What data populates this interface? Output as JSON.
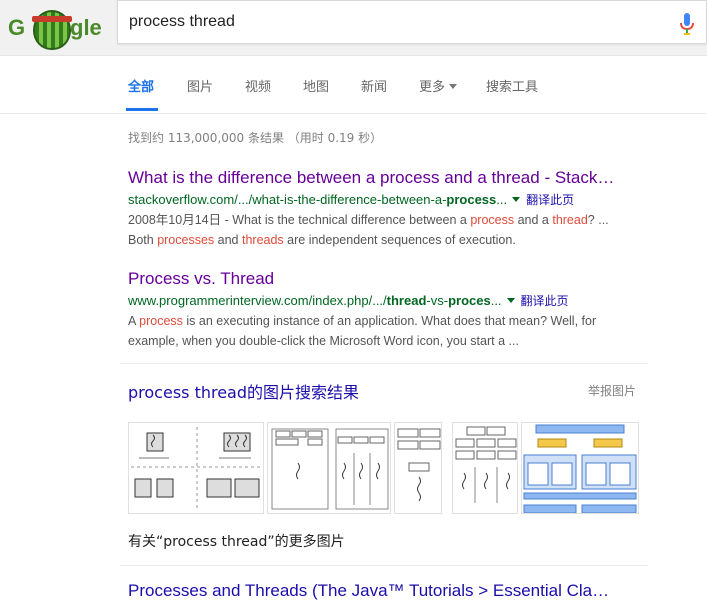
{
  "search": {
    "query": "process thread"
  },
  "tabs": [
    {
      "label": "全部"
    },
    {
      "label": "图片"
    },
    {
      "label": "视频"
    },
    {
      "label": "地图"
    },
    {
      "label": "新闻"
    },
    {
      "label": "更多"
    },
    {
      "label": "搜索工具"
    }
  ],
  "stats": "找到约 113,000,000 条结果 （用时 0.19 秒）",
  "results": [
    {
      "title": "What is the difference between a process and a thread - Stack…",
      "url_prefix": "stackoverflow.com/.../what-is-the-difference-between-a-",
      "url_bold": "process",
      "url_suffix": "...",
      "translate": "翻译此页",
      "snippet": {
        "line1": {
          "a": "2008年10月14日 - What is the technical difference between a ",
          "b": "process",
          "c": " and a ",
          "d": "thread",
          "e": "? ..."
        },
        "line2": {
          "a": "Both ",
          "b": "processes",
          "c": " and ",
          "d": "threads",
          "e": " are independent sequences of execution."
        }
      }
    },
    {
      "title": "Process vs. Thread",
      "url_prefix": "www.programmerinterview.com/index.php/.../",
      "url_bold": "thread",
      "url_mid": "-vs-",
      "url_bold2": "proces",
      "url_suffix": "...",
      "translate": "翻译此页",
      "snippet": {
        "line1": {
          "a": "A ",
          "b": "process",
          "c": " is an executing instance of an application. What does that mean? Well, for"
        },
        "line2": "example, when you double-click the Microsoft Word icon, you start a ..."
      }
    }
  ],
  "images_section": {
    "heading": "process thread的图片搜索结果",
    "report": "举报图片",
    "more": "有关“process thread”的更多图片"
  },
  "last_result": {
    "title": "Processes and Threads (The Java™ Tutorials > Essential Cla…"
  },
  "colors": {
    "link_visited": "#660099",
    "link": "#1a0dab",
    "url_green": "#006621",
    "highlight_red": "#dd4b39",
    "tab_active": "#1a73e8"
  }
}
